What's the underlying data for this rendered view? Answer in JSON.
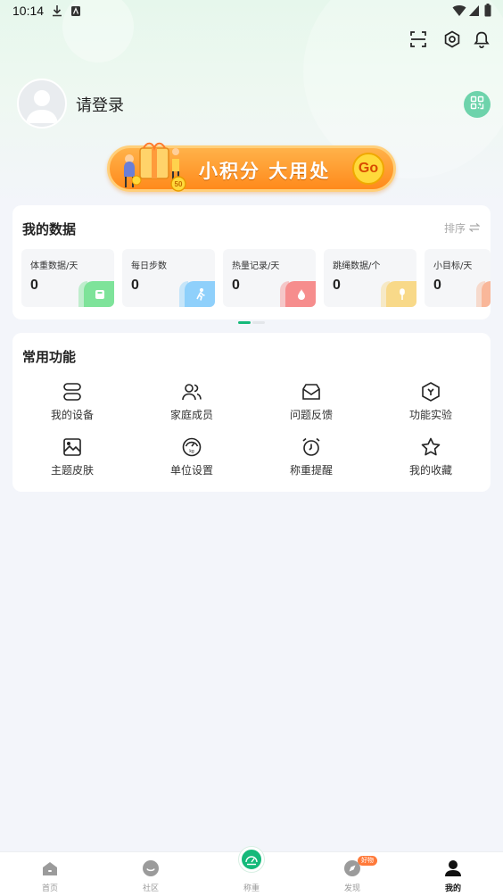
{
  "status_bar": {
    "time": "10:14"
  },
  "profile": {
    "login_prompt": "请登录"
  },
  "banner": {
    "title": "小积分 大用处",
    "go_label": "Go",
    "coin_label": "50"
  },
  "my_data": {
    "title": "我的数据",
    "sort_label": "排序",
    "metrics": [
      {
        "label": "体重数据/天",
        "value": "0",
        "color": "#7ee39a"
      },
      {
        "label": "每日步数",
        "value": "0",
        "color": "#8fd0fb"
      },
      {
        "label": "热量记录/天",
        "value": "0",
        "color": "#f68d8d"
      },
      {
        "label": "跳绳数据/个",
        "value": "0",
        "color": "#f8d989"
      },
      {
        "label": "小目标/天",
        "value": "0",
        "color": "#f9b79a"
      }
    ]
  },
  "common_functions": {
    "title": "常用功能",
    "items": [
      {
        "label": "我的设备",
        "icon": "device-icon"
      },
      {
        "label": "家庭成员",
        "icon": "family-icon"
      },
      {
        "label": "问题反馈",
        "icon": "feedback-icon"
      },
      {
        "label": "功能实验",
        "icon": "lab-icon"
      },
      {
        "label": "主题皮肤",
        "icon": "theme-icon"
      },
      {
        "label": "单位设置",
        "icon": "unit-icon"
      },
      {
        "label": "称重提醒",
        "icon": "alarm-icon"
      },
      {
        "label": "我的收藏",
        "icon": "star-icon"
      }
    ]
  },
  "bottom_nav": {
    "items": [
      {
        "label": "首页",
        "icon": "home-icon"
      },
      {
        "label": "社区",
        "icon": "community-icon"
      },
      {
        "label": "称重",
        "icon": "weigh-icon"
      },
      {
        "label": "发现",
        "icon": "discover-icon",
        "badge": "好物"
      },
      {
        "label": "我的",
        "icon": "profile-icon",
        "active": true
      }
    ]
  },
  "theme": {
    "accent": "#15b97a",
    "banner_orange": "#ff8a1c"
  }
}
